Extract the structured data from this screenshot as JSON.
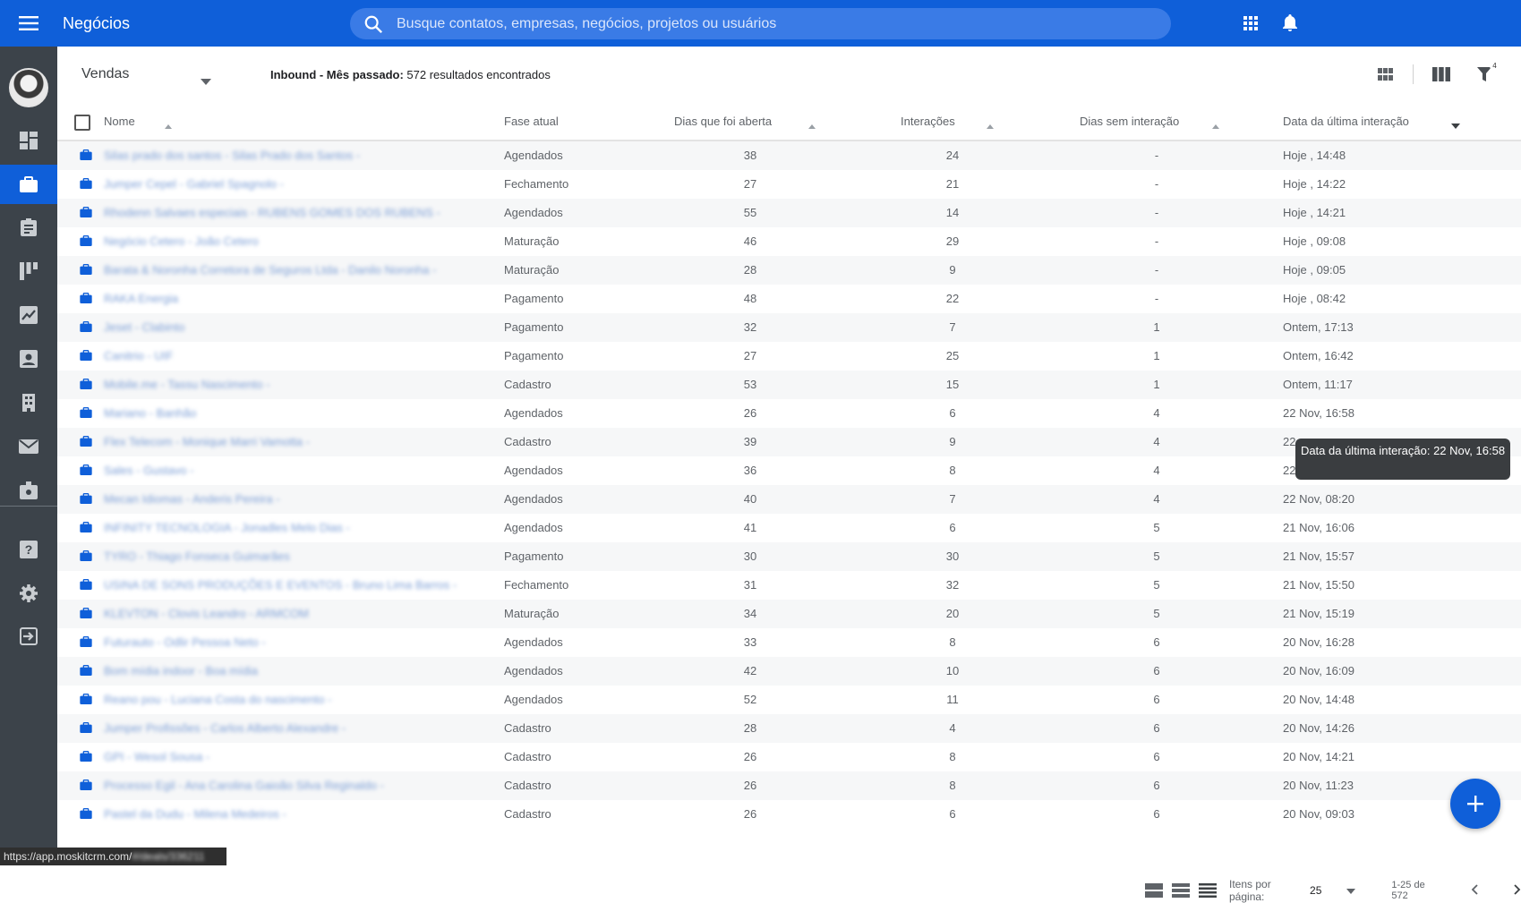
{
  "header": {
    "title": "Negócios",
    "search_placeholder": "Busque contatos, empresas, negócios, projetos ou usuários",
    "icons": [
      "menu-icon",
      "search-icon",
      "apps-grid-icon",
      "bell-icon"
    ]
  },
  "sidebar": {
    "items": [
      {
        "name": "dashboard",
        "icon": "dashboard-icon",
        "active": false
      },
      {
        "name": "deals",
        "icon": "briefcase-icon",
        "active": true
      },
      {
        "name": "tasks",
        "icon": "clipboard-icon",
        "active": false
      },
      {
        "name": "pipeline",
        "icon": "kanban-icon",
        "active": false
      },
      {
        "name": "reports",
        "icon": "chart-icon",
        "active": false
      },
      {
        "name": "contacts",
        "icon": "contact-card-icon",
        "active": false
      },
      {
        "name": "companies",
        "icon": "building-icon",
        "active": false
      },
      {
        "name": "messages",
        "icon": "mail-icon",
        "active": false
      },
      {
        "name": "projects",
        "icon": "case-icon",
        "active": false
      },
      {
        "name": "help",
        "icon": "help-icon",
        "active": false
      },
      {
        "name": "settings",
        "icon": "gear-icon",
        "active": false
      },
      {
        "name": "logout",
        "icon": "exit-icon",
        "active": false
      }
    ]
  },
  "toolbar": {
    "pipeline": "Vendas",
    "summary_bold": "Inbound - Mês passado:",
    "summary_text": " 572 resultados encontrados",
    "filter_count": "4"
  },
  "table": {
    "columns": {
      "name": "Nome",
      "stage": "Fase atual",
      "days_open": "Dias que foi aberta",
      "interactions": "Interações",
      "days_without": "Dias sem interação",
      "last_interaction": "Data da última interação"
    },
    "rows": [
      {
        "name": "Silas prado dos santos - Silas Prado dos Santos -",
        "stage": "Agendados",
        "days_open": "38",
        "interactions": "24",
        "days_without": "-",
        "last": "Hoje , 14:48"
      },
      {
        "name": "Jumper Cepel - Gabriel Spagnolo -",
        "stage": "Fechamento",
        "days_open": "27",
        "interactions": "21",
        "days_without": "-",
        "last": "Hoje , 14:22"
      },
      {
        "name": "Rhodenn Salvaes especiais - RUBENS GOMES DOS RUBENS -",
        "stage": "Agendados",
        "days_open": "55",
        "interactions": "14",
        "days_without": "-",
        "last": "Hoje , 14:21"
      },
      {
        "name": "Negócio Cetero - João Cetero",
        "stage": "Maturação",
        "days_open": "46",
        "interactions": "29",
        "days_without": "-",
        "last": "Hoje , 09:08"
      },
      {
        "name": "Barata & Noronha Corretora de Seguros Ltda - Danilo Noronha -",
        "stage": "Maturação",
        "days_open": "28",
        "interactions": "9",
        "days_without": "-",
        "last": "Hoje , 09:05"
      },
      {
        "name": "RAKA Energia",
        "stage": "Pagamento",
        "days_open": "48",
        "interactions": "22",
        "days_without": "-",
        "last": "Hoje , 08:42"
      },
      {
        "name": "Jeset - Clabinto",
        "stage": "Pagamento",
        "days_open": "32",
        "interactions": "7",
        "days_without": "1",
        "last": "Ontem, 17:13"
      },
      {
        "name": "Canitrio - UIF",
        "stage": "Pagamento",
        "days_open": "27",
        "interactions": "25",
        "days_without": "1",
        "last": "Ontem, 16:42"
      },
      {
        "name": "Mobile.me - Tassu Nascimento -",
        "stage": "Cadastro",
        "days_open": "53",
        "interactions": "15",
        "days_without": "1",
        "last": "Ontem, 11:17"
      },
      {
        "name": "Mariano - Banhão",
        "stage": "Agendados",
        "days_open": "26",
        "interactions": "6",
        "days_without": "4",
        "last": "22 Nov, 16:58"
      },
      {
        "name": "Flex Telecom - Monique Marri Vamotta -",
        "stage": "Cadastro",
        "days_open": "39",
        "interactions": "9",
        "days_without": "4",
        "last": "22"
      },
      {
        "name": "Sales - Gustavo -",
        "stage": "Agendados",
        "days_open": "36",
        "interactions": "8",
        "days_without": "4",
        "last": "22"
      },
      {
        "name": "Mecan Idiomas - Anderis Pereira -",
        "stage": "Agendados",
        "days_open": "40",
        "interactions": "7",
        "days_without": "4",
        "last": "22 Nov, 08:20"
      },
      {
        "name": "INFINITY TECNOLOGIA - Jonadles Melo Dias -",
        "stage": "Agendados",
        "days_open": "41",
        "interactions": "6",
        "days_without": "5",
        "last": "21 Nov, 16:06"
      },
      {
        "name": "TYRO - Thiago Fonseca Guimarães",
        "stage": "Pagamento",
        "days_open": "30",
        "interactions": "30",
        "days_without": "5",
        "last": "21 Nov, 15:57"
      },
      {
        "name": "USINA DE SONS PRODUÇÕES E EVENTOS - Bruno Lima Barros -",
        "stage": "Fechamento",
        "days_open": "31",
        "interactions": "32",
        "days_without": "5",
        "last": "21 Nov, 15:50"
      },
      {
        "name": "KLEVTON - Clovis Leandro - ARMCOM",
        "stage": "Maturação",
        "days_open": "34",
        "interactions": "20",
        "days_without": "5",
        "last": "21 Nov, 15:19"
      },
      {
        "name": "Futurauto - Odlir Pessoa Neto -",
        "stage": "Agendados",
        "days_open": "33",
        "interactions": "8",
        "days_without": "6",
        "last": "20 Nov, 16:28"
      },
      {
        "name": "Bom mídia indoor - Boa mídia",
        "stage": "Agendados",
        "days_open": "42",
        "interactions": "10",
        "days_without": "6",
        "last": "20 Nov, 16:09"
      },
      {
        "name": "Reano pou - Luciana Costa do nascimento -",
        "stage": "Agendados",
        "days_open": "52",
        "interactions": "11",
        "days_without": "6",
        "last": "20 Nov, 14:48"
      },
      {
        "name": "Jumper Profissões - Carlos Alberto Alexandre -",
        "stage": "Cadastro",
        "days_open": "28",
        "interactions": "4",
        "days_without": "6",
        "last": "20 Nov, 14:26"
      },
      {
        "name": "GPI - Wesol Sousa -",
        "stage": "Cadastro",
        "days_open": "26",
        "interactions": "8",
        "days_without": "6",
        "last": "20 Nov, 14:21"
      },
      {
        "name": "Processo Egil - Ana Carolina Gaioão Silva Reginaldo -",
        "stage": "Cadastro",
        "days_open": "26",
        "interactions": "8",
        "days_without": "6",
        "last": "20 Nov, 11:23"
      },
      {
        "name": "Pastel da Dudu - Milena Medeiros -",
        "stage": "Cadastro",
        "days_open": "26",
        "interactions": "6",
        "days_without": "6",
        "last": "20 Nov, 09:03"
      }
    ]
  },
  "tooltip": {
    "text": "Data da última interação: 22 Nov, 16:58"
  },
  "footer": {
    "items_label": "Itens por página:",
    "per_page": "25",
    "range": "1-25 de 572"
  },
  "status_bar": {
    "url": "https://app.moskitcrm.com/",
    "url_tail": "#/deals/336211"
  },
  "colors": {
    "brand": "#0f5fd9",
    "sidebar": "#3c434a",
    "tooltip": "#3a3d40"
  }
}
